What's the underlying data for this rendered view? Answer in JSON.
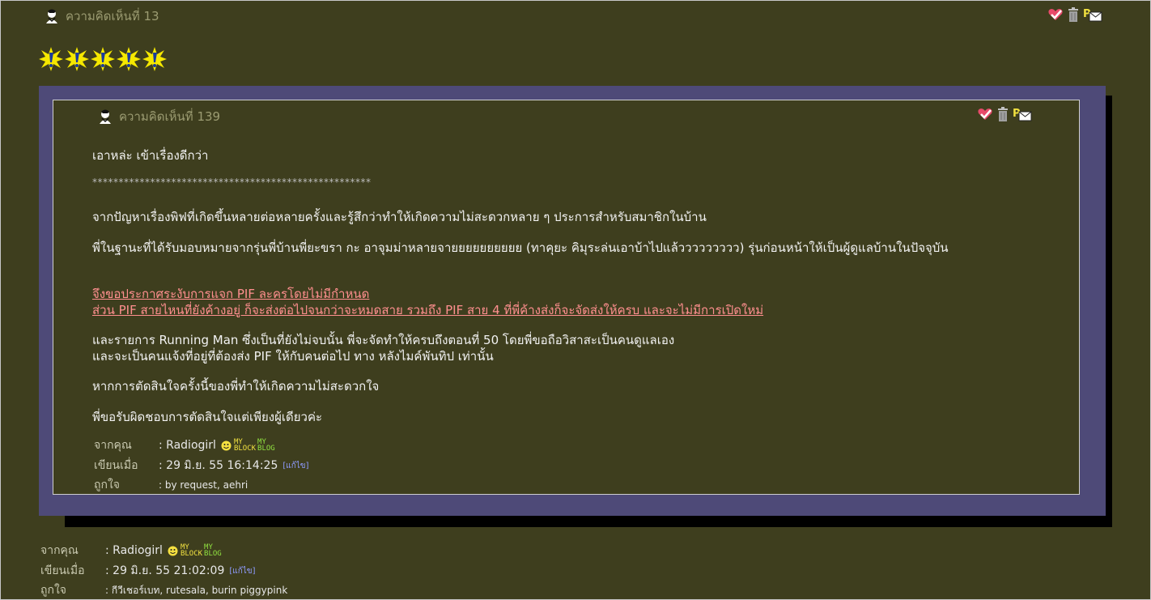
{
  "outer_comment": {
    "title": "ความคิดเห็นที่ 13",
    "author_label": "จากคุณ",
    "author_value": ": Radiogirl",
    "time_label": "เขียนเมื่อ",
    "time_value": ": 29 มิ.ย. 55 21:02:09",
    "edit_label": "[แก้ไข]",
    "likes_label": "ถูกใจ",
    "likes_value": ": กีวีเชอร์เบท, rutesala, burin piggypink"
  },
  "quoted_comment": {
    "title": "ความคิดเห็นที่ 139",
    "greeting": "เอาหล่ะ เข้าเรื่องดีกว่า",
    "stars": "*****************************************************",
    "para1": "จากปัญหาเรื่องพิฟที่เกิดขึ้นหลายต่อหลายครั้งและรู้สึกว่าทำให้เกิดความไม่สะดวกหลาย ๆ ประการสำหรับสมาชิกในบ้าน",
    "para2": "พี่ในฐานะที่ได้รับมอบหมายจากรุ่นพี่บ้านพี่ยะขรา กะ อาจุมม่าหลายจายยยยยยยยยย (ทาคุยะ คิมุระล่นเอาบ้าไปแล้ววววววววว)  รุ่นก่อนหน้าให้เป็นผู้ดูแลบ้านในปัจจุบัน",
    "announce1": "จึงขอประกาศระงับการแจก PIF ละครโดยไม่มีกำหนด",
    "announce2": "ส่วน PIF สายไหนที่ยังค้างอยู่ ก็จะส่งต่อไปจนกว่าจะหมดสาย รวมถึง PIF สาย 4 ที่พี่ค้างส่งก็จะจัดส่งให้ครบ และจะไม่มีการเปิดใหม่",
    "para3a": "และรายการ Running Man ซึ่งเป็นที่ยังไม่จบนั้น พี่จะจัดทำให้ครบถึงตอนที่ 50 โดยพี่ขอถือวิสาสะเป็นคนดูแลเอง",
    "para3b": "และจะเป็นคนแจ้งที่อยู่ที่ต้องส่ง PIF ให้กับคนต่อไป ทาง หลังไมค์พันทิป เท่านั้น",
    "para4": "หากการตัดสินใจครั้งนี้ของพี่ทำให้เกิดความไม่สะดวกใจ",
    "para5": "พี่ขอรับผิดชอบการตัดสินใจแต่เพียงผู้เดียวค่ะ",
    "author_label": "จากคุณ",
    "author_value": ": Radiogirl",
    "time_label": "เขียนเมื่อ",
    "time_value": ": 29 มิ.ย. 55 16:14:25",
    "edit_label": "[แก้ไข]",
    "likes_label": "ถูกใจ",
    "likes_value": ": by request, aehri"
  },
  "badges": {
    "my": "MY",
    "block": "BLOCK",
    "blog": "BLOG"
  },
  "colors": {
    "background": "#3e3e1e",
    "quote_border": "#4e4a78",
    "link": "#ff8f8f",
    "edit": "#8f9bff"
  },
  "icons": [
    "user-icon",
    "like-check-icon",
    "trash-icon",
    "pm-mail-icon",
    "exclaim-burst-icon",
    "smiley-icon"
  ]
}
